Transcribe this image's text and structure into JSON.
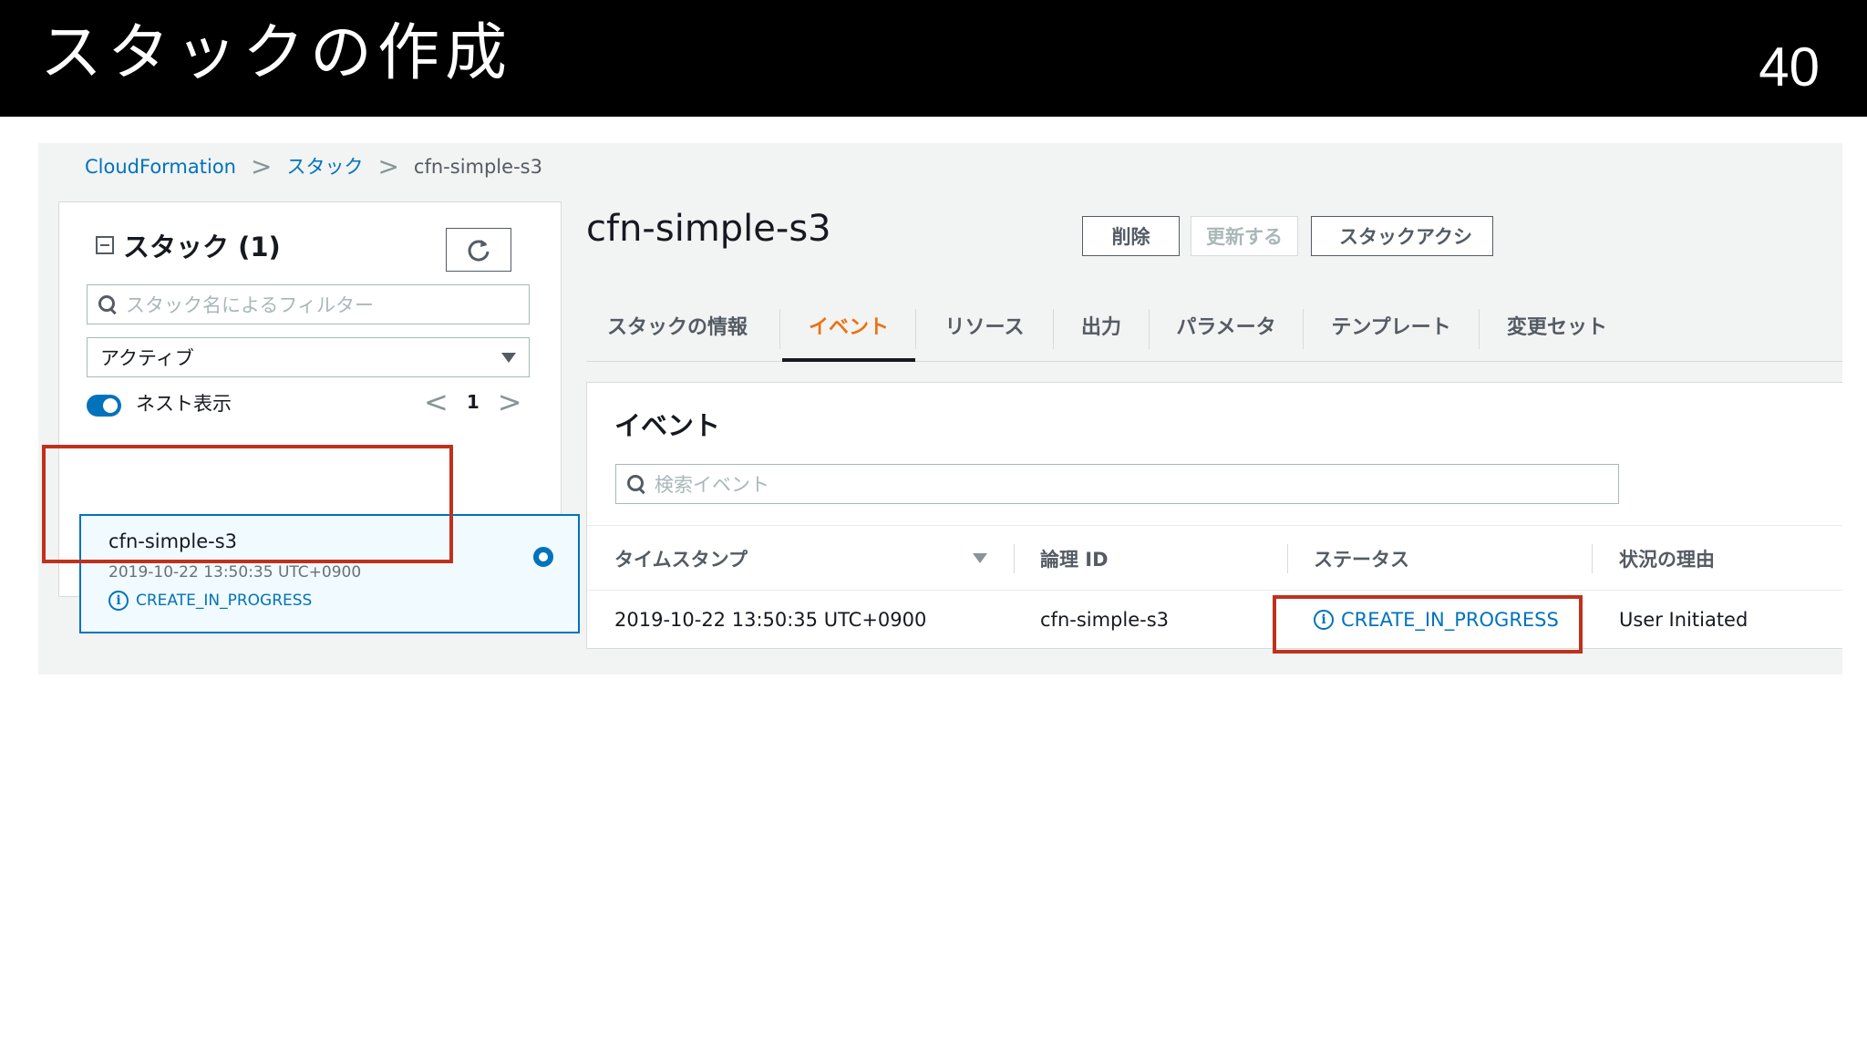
{
  "slide": {
    "title": "スタックの作成",
    "page_number": "40"
  },
  "breadcrumb": {
    "items": [
      "CloudFormation",
      "スタック",
      "cfn-simple-s3"
    ],
    "separator": ">"
  },
  "left_panel": {
    "title": "スタック (1)",
    "refresh_icon": "refresh-icon",
    "search_placeholder": "スタック名によるフィルター",
    "filter_select_value": "アクティブ",
    "nested_toggle_label": "ネスト表示",
    "nested_toggle_on": true,
    "page_prev": "<",
    "page_current": "1",
    "page_next": ">",
    "stack": {
      "name": "cfn-simple-s3",
      "created": "2019-10-22 13:50:35 UTC+0900",
      "status": "CREATE_IN_PROGRESS",
      "selected": true
    }
  },
  "main": {
    "stack_name": "cfn-simple-s3",
    "actions": {
      "delete": "削除",
      "update": "更新する",
      "stack_actions": "スタックアクシ"
    },
    "tabs": [
      {
        "label": "スタックの情報",
        "active": false
      },
      {
        "label": "イベント",
        "active": true
      },
      {
        "label": "リソース",
        "active": false
      },
      {
        "label": "出力",
        "active": false
      },
      {
        "label": "パラメータ",
        "active": false
      },
      {
        "label": "テンプレート",
        "active": false
      },
      {
        "label": "変更セット",
        "active": false
      }
    ],
    "events": {
      "title": "イベント",
      "search_placeholder": "検索イベント",
      "columns": [
        "タイムスタンプ",
        "論理 ID",
        "ステータス",
        "状況の理由"
      ],
      "rows": [
        {
          "timestamp": "2019-10-22 13:50:35 UTC+0900",
          "logical_id": "cfn-simple-s3",
          "status": "CREATE_IN_PROGRESS",
          "reason": "User Initiated"
        }
      ]
    }
  },
  "colors": {
    "link": "#0073bb",
    "active_tab": "#ec7211",
    "highlight_box": "#c0311c",
    "header_bg": "#000000"
  }
}
